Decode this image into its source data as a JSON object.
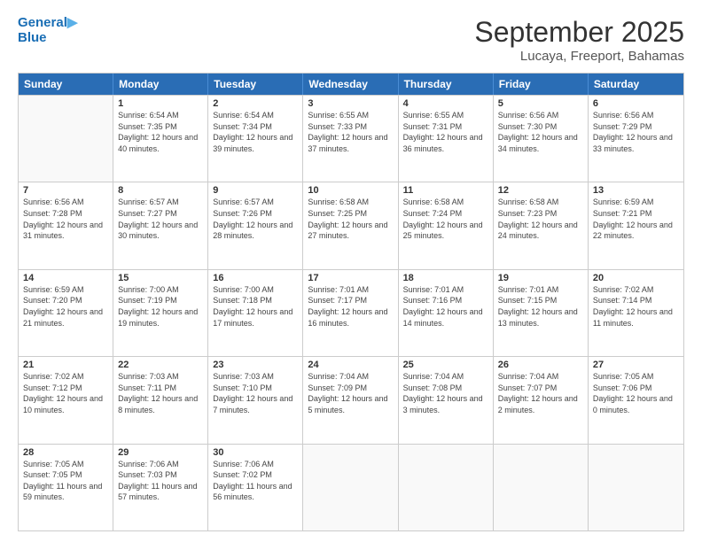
{
  "header": {
    "logo_line1": "General",
    "logo_line2": "Blue",
    "month": "September 2025",
    "location": "Lucaya, Freeport, Bahamas"
  },
  "days_of_week": [
    "Sunday",
    "Monday",
    "Tuesday",
    "Wednesday",
    "Thursday",
    "Friday",
    "Saturday"
  ],
  "weeks": [
    [
      {
        "day": null
      },
      {
        "day": "1",
        "sunrise": "6:54 AM",
        "sunset": "7:35 PM",
        "daylight": "12 hours and 40 minutes."
      },
      {
        "day": "2",
        "sunrise": "6:54 AM",
        "sunset": "7:34 PM",
        "daylight": "12 hours and 39 minutes."
      },
      {
        "day": "3",
        "sunrise": "6:55 AM",
        "sunset": "7:33 PM",
        "daylight": "12 hours and 37 minutes."
      },
      {
        "day": "4",
        "sunrise": "6:55 AM",
        "sunset": "7:31 PM",
        "daylight": "12 hours and 36 minutes."
      },
      {
        "day": "5",
        "sunrise": "6:56 AM",
        "sunset": "7:30 PM",
        "daylight": "12 hours and 34 minutes."
      },
      {
        "day": "6",
        "sunrise": "6:56 AM",
        "sunset": "7:29 PM",
        "daylight": "12 hours and 33 minutes."
      }
    ],
    [
      {
        "day": "7",
        "sunrise": "6:56 AM",
        "sunset": "7:28 PM",
        "daylight": "12 hours and 31 minutes."
      },
      {
        "day": "8",
        "sunrise": "6:57 AM",
        "sunset": "7:27 PM",
        "daylight": "12 hours and 30 minutes."
      },
      {
        "day": "9",
        "sunrise": "6:57 AM",
        "sunset": "7:26 PM",
        "daylight": "12 hours and 28 minutes."
      },
      {
        "day": "10",
        "sunrise": "6:58 AM",
        "sunset": "7:25 PM",
        "daylight": "12 hours and 27 minutes."
      },
      {
        "day": "11",
        "sunrise": "6:58 AM",
        "sunset": "7:24 PM",
        "daylight": "12 hours and 25 minutes."
      },
      {
        "day": "12",
        "sunrise": "6:58 AM",
        "sunset": "7:23 PM",
        "daylight": "12 hours and 24 minutes."
      },
      {
        "day": "13",
        "sunrise": "6:59 AM",
        "sunset": "7:21 PM",
        "daylight": "12 hours and 22 minutes."
      }
    ],
    [
      {
        "day": "14",
        "sunrise": "6:59 AM",
        "sunset": "7:20 PM",
        "daylight": "12 hours and 21 minutes."
      },
      {
        "day": "15",
        "sunrise": "7:00 AM",
        "sunset": "7:19 PM",
        "daylight": "12 hours and 19 minutes."
      },
      {
        "day": "16",
        "sunrise": "7:00 AM",
        "sunset": "7:18 PM",
        "daylight": "12 hours and 17 minutes."
      },
      {
        "day": "17",
        "sunrise": "7:01 AM",
        "sunset": "7:17 PM",
        "daylight": "12 hours and 16 minutes."
      },
      {
        "day": "18",
        "sunrise": "7:01 AM",
        "sunset": "7:16 PM",
        "daylight": "12 hours and 14 minutes."
      },
      {
        "day": "19",
        "sunrise": "7:01 AM",
        "sunset": "7:15 PM",
        "daylight": "12 hours and 13 minutes."
      },
      {
        "day": "20",
        "sunrise": "7:02 AM",
        "sunset": "7:14 PM",
        "daylight": "12 hours and 11 minutes."
      }
    ],
    [
      {
        "day": "21",
        "sunrise": "7:02 AM",
        "sunset": "7:12 PM",
        "daylight": "12 hours and 10 minutes."
      },
      {
        "day": "22",
        "sunrise": "7:03 AM",
        "sunset": "7:11 PM",
        "daylight": "12 hours and 8 minutes."
      },
      {
        "day": "23",
        "sunrise": "7:03 AM",
        "sunset": "7:10 PM",
        "daylight": "12 hours and 7 minutes."
      },
      {
        "day": "24",
        "sunrise": "7:04 AM",
        "sunset": "7:09 PM",
        "daylight": "12 hours and 5 minutes."
      },
      {
        "day": "25",
        "sunrise": "7:04 AM",
        "sunset": "7:08 PM",
        "daylight": "12 hours and 3 minutes."
      },
      {
        "day": "26",
        "sunrise": "7:04 AM",
        "sunset": "7:07 PM",
        "daylight": "12 hours and 2 minutes."
      },
      {
        "day": "27",
        "sunrise": "7:05 AM",
        "sunset": "7:06 PM",
        "daylight": "12 hours and 0 minutes."
      }
    ],
    [
      {
        "day": "28",
        "sunrise": "7:05 AM",
        "sunset": "7:05 PM",
        "daylight": "11 hours and 59 minutes."
      },
      {
        "day": "29",
        "sunrise": "7:06 AM",
        "sunset": "7:03 PM",
        "daylight": "11 hours and 57 minutes."
      },
      {
        "day": "30",
        "sunrise": "7:06 AM",
        "sunset": "7:02 PM",
        "daylight": "11 hours and 56 minutes."
      },
      {
        "day": null
      },
      {
        "day": null
      },
      {
        "day": null
      },
      {
        "day": null
      }
    ]
  ]
}
